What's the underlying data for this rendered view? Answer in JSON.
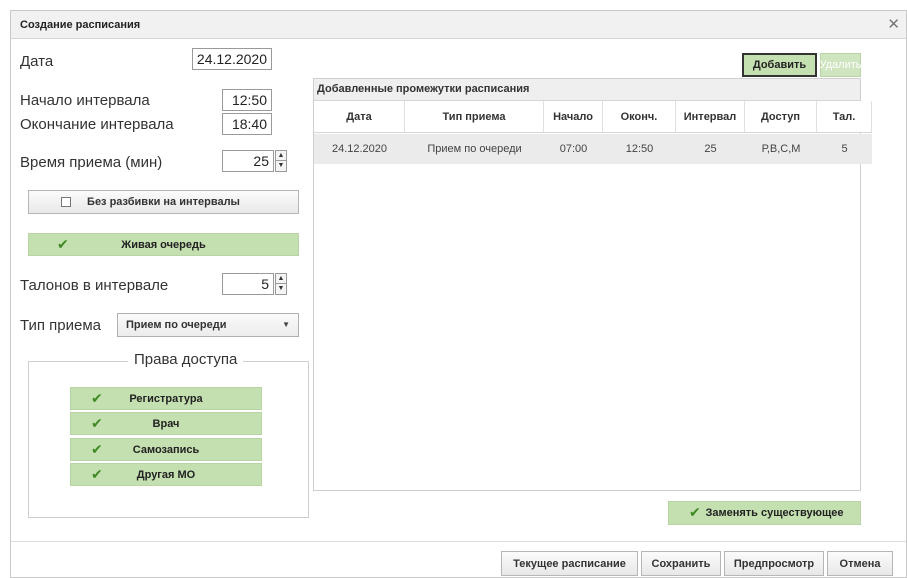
{
  "dialog": {
    "title": "Создание расписания",
    "close_icon": "close-icon"
  },
  "form": {
    "date_label": "Дата",
    "date_value": "24.12.2020",
    "start_label": "Начало интервала",
    "start_value": "12:50",
    "end_label": "Окончание интервала",
    "end_value": "18:40",
    "duration_label": "Время приема (мин)",
    "duration_value": "25",
    "no_split_label": "Без разбивки на интервалы",
    "live_queue_label": "Живая очередь",
    "tickets_label": "Талонов в интервале",
    "tickets_value": "5",
    "type_label": "Тип приема",
    "type_value": "Прием по очереди"
  },
  "access": {
    "legend": "Права доступа",
    "items": [
      "Регистратура",
      "Врач",
      "Самозапись",
      "Другая МО"
    ]
  },
  "toolbar": {
    "add_label": "Добавить",
    "delete_label": "Удалить"
  },
  "table": {
    "title": "Добавленные промежутки расписания",
    "columns": [
      "Дата",
      "Тип приема",
      "Начало",
      "Оконч.",
      "Интервал",
      "Доступ",
      "Тал."
    ],
    "rows": [
      [
        "24.12.2020",
        "Прием по очереди",
        "07:00",
        "12:50",
        "25",
        "Р,В,С,М",
        "5"
      ]
    ]
  },
  "replace_label": "Заменять существующее",
  "footer": {
    "current_label": "Текущее расписание",
    "save_label": "Сохранить",
    "preview_label": "Предпросмотр",
    "cancel_label": "Отмена"
  },
  "colors": {
    "green_button": "#c4dfb0",
    "check": "#3f8a24"
  }
}
